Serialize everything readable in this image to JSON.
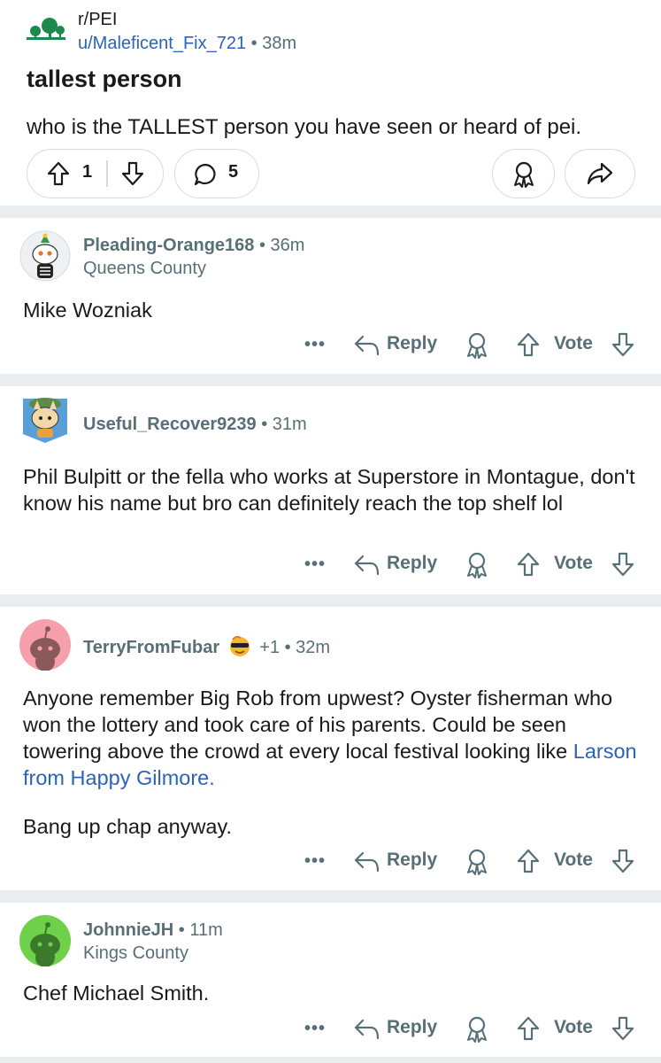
{
  "post": {
    "subreddit": "r/PEI",
    "author": "u/Maleficent_Fix_721",
    "separator": "•",
    "time": "38m",
    "title": "tallest person",
    "body": "who is the TALLEST person you have seen or heard of pei.",
    "score": "1",
    "comment_count": "5"
  },
  "actions": {
    "more": "•••",
    "reply": "Reply",
    "vote": "Vote"
  },
  "comments": [
    {
      "author": "Pleading-Orange168",
      "time": " • 36m",
      "flair": "Queens County",
      "text": "Mike Wozniak"
    },
    {
      "author": "Useful_Recover9239",
      "time": " • 31m",
      "text": "Phil Bulpitt or the fella who works at Superstore in Montague, don't know his name but bro can definitely reach the top shelf lol"
    },
    {
      "author": "TerryFromFubar",
      "extra": "+1 • 32m",
      "text_lead": "Anyone remember Big Rob from upwest? Oyster fisherman who won the lottery and took care of his parents. Could be seen towering above the crowd at every local festival looking like ",
      "text_link": "Larson from Happy Gilmore.",
      "text2": "Bang up chap anyway."
    },
    {
      "author": "JohnnieJH",
      "time": " • 11m",
      "flair": "Kings County",
      "text": "Chef Michael Smith."
    }
  ],
  "colors": {
    "meta": "#576f76",
    "link": "#2a63b8",
    "divider": "#eaedef"
  }
}
